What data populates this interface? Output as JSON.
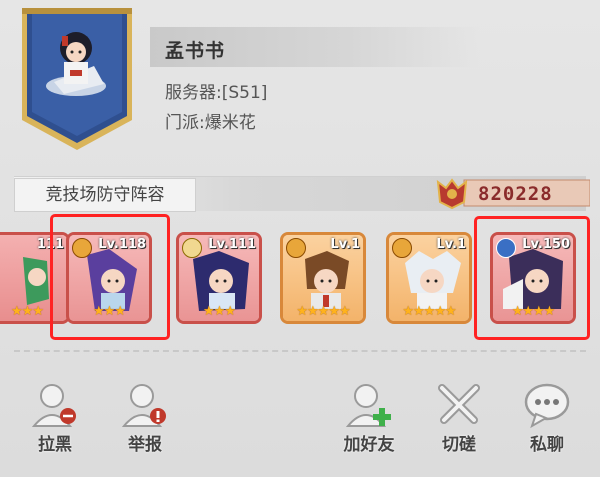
{
  "player": {
    "name": "孟书书",
    "server": "服务器:[S51]",
    "faction": "门派:爆米花"
  },
  "section": {
    "title": "竞技场防守阵容",
    "power": "820228"
  },
  "heroes": [
    {
      "level": "111",
      "stars": "★★★",
      "frame": "partial"
    },
    {
      "level": "Lv.118",
      "stars": "★★★",
      "selected": true
    },
    {
      "level": "Lv.111",
      "stars": "★★★"
    },
    {
      "level": "Lv.1",
      "stars": "★★★★★"
    },
    {
      "level": "Lv.1",
      "stars": "★★★★★"
    },
    {
      "level": "Lv.150",
      "stars": "★★★★",
      "selected": true
    }
  ],
  "actions": {
    "block": "拉黑",
    "report": "举报",
    "add_friend": "加好友",
    "duel": "切磋",
    "message": "私聊"
  },
  "colors": {
    "banner": "#2f4f8f",
    "banner_border": "#d9b45a",
    "power_text": "#8a2b2b",
    "highlight": "#ff2222"
  }
}
